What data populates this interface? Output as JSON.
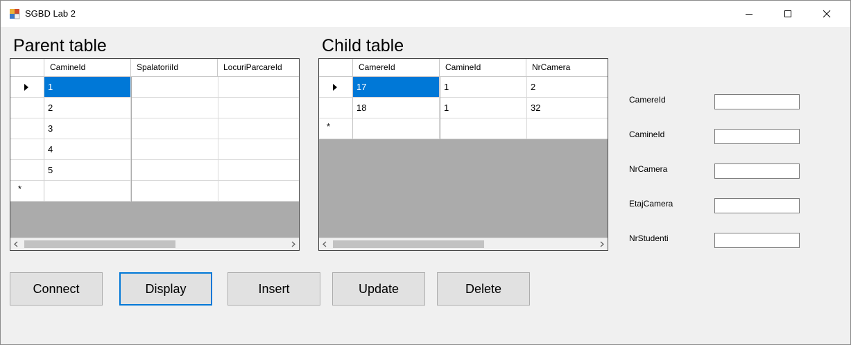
{
  "window": {
    "title": "SGBD Lab 2",
    "controls": [
      "minimize",
      "maximize",
      "close"
    ]
  },
  "parent": {
    "title": "Parent table",
    "columns": [
      "CamineId",
      "SpalatoriiId",
      "LocuriParcareId"
    ],
    "rows": [
      [
        "1",
        "",
        ""
      ],
      [
        "2",
        "",
        ""
      ],
      [
        "3",
        "",
        ""
      ],
      [
        "4",
        "",
        ""
      ],
      [
        "5",
        "",
        ""
      ]
    ],
    "new_row_marker": "*",
    "selected_row": 0
  },
  "child": {
    "title": "Child table",
    "columns": [
      "CamereId",
      "CamineId",
      "NrCamera"
    ],
    "rows": [
      [
        "17",
        "1",
        "2"
      ],
      [
        "18",
        "1",
        "32"
      ]
    ],
    "new_row_marker": "*",
    "selected_row": 0
  },
  "fields": [
    {
      "label": "CamereId",
      "value": ""
    },
    {
      "label": "CamineId",
      "value": ""
    },
    {
      "label": "NrCamera",
      "value": ""
    },
    {
      "label": "EtajCamera",
      "value": ""
    },
    {
      "label": "NrStudenti",
      "value": ""
    }
  ],
  "buttons": {
    "connect": "Connect",
    "display": "Display",
    "insert": "Insert",
    "update": "Update",
    "delete": "Delete"
  },
  "scroll": {
    "left_arrow": "chevron-left-icon",
    "right_arrow": "chevron-right-icon"
  },
  "colors": {
    "selection": "#0078d7",
    "grid_background": "#ababab",
    "window_background": "#f0f0f0",
    "focus_border": "#0078d7"
  }
}
